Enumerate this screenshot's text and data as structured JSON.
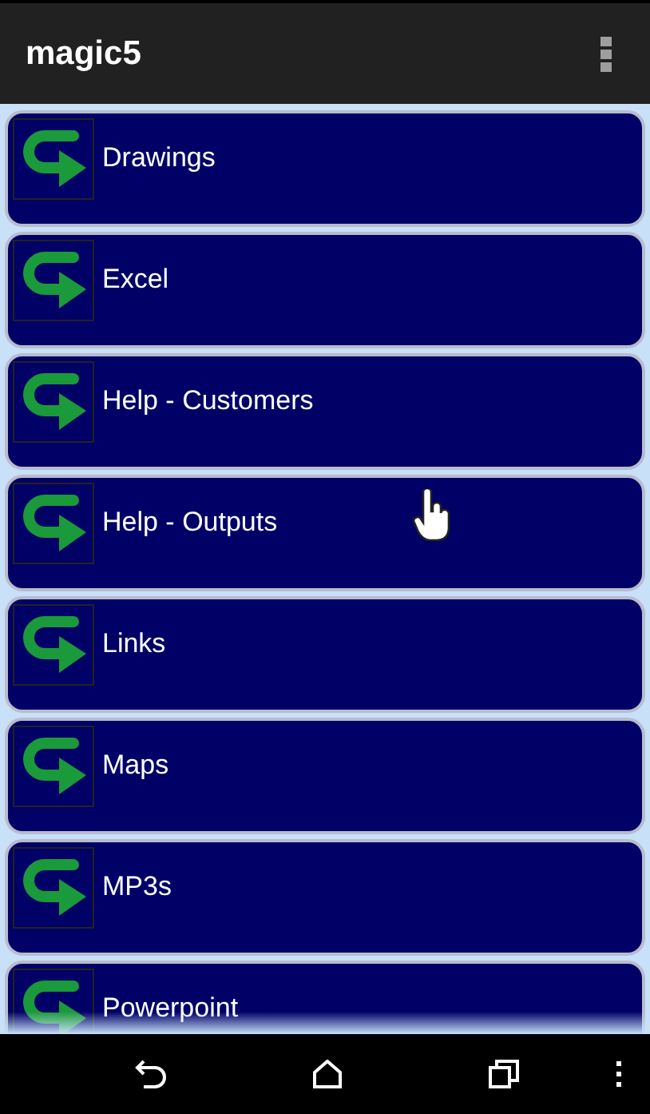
{
  "app_bar": {
    "title": "magic5"
  },
  "items": [
    {
      "label": "Drawings"
    },
    {
      "label": "Excel"
    },
    {
      "label": "Help - Customers"
    },
    {
      "label": "Help - Outputs"
    },
    {
      "label": "Links"
    },
    {
      "label": "Maps"
    },
    {
      "label": "MP3s"
    },
    {
      "label": "Powerpoint"
    }
  ]
}
